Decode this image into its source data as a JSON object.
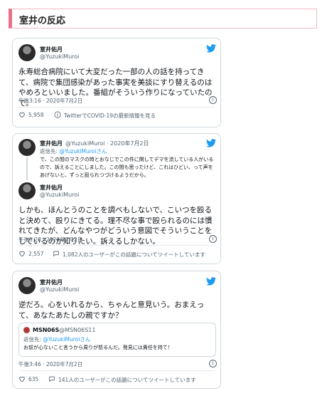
{
  "section": {
    "title": "室井の反応"
  },
  "colors": {
    "twitter_blue": "#1d9bf0",
    "heart": "#536471",
    "accent_pink": "#e8708a"
  },
  "tweets": [
    {
      "name": "室井佑月",
      "handle": "@YuzukiMuroi",
      "text": "永寿総合病院にいて大変だった一部の人の話を持ってきて、病院で集団感染があった事実を美談にすり替えるのはやめろといいました。番組がそういう作りになっていたので。",
      "time": "午後3:16 · 2020年7月2日",
      "likes": "5,958",
      "extra": "TwitterでCOVID-19の最新情報を見る"
    },
    {
      "parent": {
        "name": "室井佑月",
        "handle": "@YuzukiMuroi · 2020年7月2日",
        "reply_label": "返信先:",
        "reply_handle": "@YuzukiMuroiさん",
        "text": "で、この間のマスクの時とおなじでこの件に関してデマを流している人がいるので、訴えることにしました。この間も思ったけど、これはひどい、って声をあげないと、ずっと殴られつづけるようだから。"
      },
      "name": "室井佑月",
      "handle": "@YuzukiMuroi",
      "text": "しかも、ほんとうのことを調べもしないで、こいつを殴ると決めて、殴りにきてる。理不尽な事で殴られるのには慣れてきたが、どんなやつがどういう意図でそういうことをしているのか知りたい。訴えるしかない。",
      "time": "午後3:28 · 2020年7月2日",
      "likes": "2,557",
      "extra": "1,082人のユーザーがこの話題についてツイートしています"
    },
    {
      "name": "室井佑月",
      "handle": "@YuzukiMuroi",
      "text": "逆だろ。心をいれるから、ちゃんと意見いう。おまえって、あなたあたしの親ですか？",
      "quote": {
        "name": "MSN06S",
        "handle": "@MSN06S11",
        "reply_label": "返信先:",
        "reply_handle": "@YuzukiMuroiさん",
        "text": "お前が心ないこと言うから周りが怒るんだ。発見には責任を持て！"
      },
      "time": "午後3:46 · 2020年7月2日",
      "likes": "635",
      "extra": "141人のユーザーがこの話題についてツイートしています"
    }
  ]
}
